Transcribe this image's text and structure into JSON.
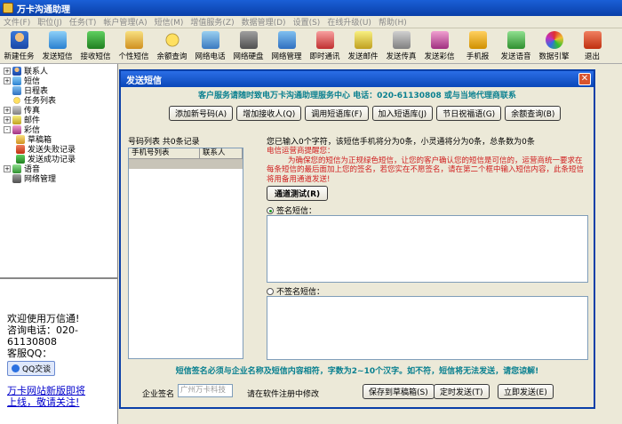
{
  "window": {
    "title": "万卡沟通助理"
  },
  "menu": [
    "文件(F)",
    "职位(J)",
    "任务(T)",
    "帐户管理(A)",
    "短信(M)",
    "增值服务(Z)",
    "数据管理(D)",
    "设置(S)",
    "在线升级(U)",
    "帮助(H)"
  ],
  "toolbar": [
    {
      "label": "新建任务",
      "icon": "user-icon"
    },
    {
      "label": "发送短信",
      "icon": "mail-icon"
    },
    {
      "label": "接收短信",
      "icon": "receive-icon"
    },
    {
      "label": "个性短信",
      "icon": "pen-icon"
    },
    {
      "label": "余额查询",
      "icon": "coin-icon"
    },
    {
      "label": "网络电话",
      "icon": "phone-icon"
    },
    {
      "label": "网络硬盘",
      "icon": "disk-icon"
    },
    {
      "label": "网络管理",
      "icon": "network-icon"
    },
    {
      "label": "即时通讯",
      "icon": "chat-icon"
    },
    {
      "label": "发送邮件",
      "icon": "send-mail-icon"
    },
    {
      "label": "发送传真",
      "icon": "fax-icon"
    },
    {
      "label": "发送彩信",
      "icon": "mms-icon"
    },
    {
      "label": "手机报",
      "icon": "mobile-news-icon"
    },
    {
      "label": "发送语音",
      "icon": "voice-icon"
    },
    {
      "label": "数据引擎",
      "icon": "engine-icon"
    },
    {
      "label": "退出",
      "icon": "exit-icon"
    }
  ],
  "tree": [
    {
      "label": "联系人",
      "level": 0,
      "expander": "+"
    },
    {
      "label": "短信",
      "level": 0,
      "expander": "+"
    },
    {
      "label": "日程表",
      "level": 0,
      "expander": ""
    },
    {
      "label": "任务列表",
      "level": 0,
      "expander": ""
    },
    {
      "label": "传真",
      "level": 0,
      "expander": "+"
    },
    {
      "label": "邮件",
      "level": 0,
      "expander": "+"
    },
    {
      "label": "彩信",
      "level": 0,
      "expander": "-"
    },
    {
      "label": "草稿箱",
      "level": 1,
      "expander": ""
    },
    {
      "label": "发送失败记录",
      "level": 1,
      "expander": ""
    },
    {
      "label": "发送成功记录",
      "level": 1,
      "expander": ""
    },
    {
      "label": "语音",
      "level": 0,
      "expander": "+"
    },
    {
      "label": "网络管理",
      "level": 0,
      "expander": ""
    }
  ],
  "ad": {
    "welcome": "欢迎使用万信通!",
    "hotline_label": "咨询电话：020-",
    "hotline_num": "61130808",
    "qq_label": "客服QQ：",
    "qq_button": "QQ交谈",
    "link_line1": "万卡网站新版即将",
    "link_line2": "上线，敬请关注!"
  },
  "dialog": {
    "title": "发送短信",
    "banner": "客户服务请随时致电万卡沟通助理服务中心  电话：020-61130808  或与当地代理商联系",
    "buttons": [
      "添加新号码(A)",
      "增加接收人(Q)",
      "调用短语库(F)",
      "加入短语库(J)",
      "节日祝福语(G)",
      "余额查询(B)"
    ],
    "number_list_label": "号码列表  共0条记录",
    "col_phone": "手机号列表",
    "col_contact": "联系人",
    "char_count": "您已输入0个字符，该短信手机将分为0条，小灵通将分为0条，总条数为0条",
    "notice_title": "电信运营商提醒您：",
    "notice_body": "为确保您的短信为正规绿色短信，让您的客户确认您的短信是可信的，运营商统一要求在每条短信的最后面加上您的签名，若您实在不愿签名，请在第二个框中输入短信内容，此条短信将用备用通道发送!",
    "channel_test": "通道测试(R)",
    "signed_label": "签名短信：",
    "unsigned_label": "不签名短信：",
    "warning": "短信签名必须与企业名称及短信内容相符，字数为2~10个汉字。如不符，短信将无法发送，请您谅解!",
    "company_label": "企业签名",
    "company_value": "广州万卡科技",
    "company_hint": "请在软件注册中修改",
    "save_draft": "保存到草稿箱(S)",
    "schedule_send": "定时发送(T)",
    "send_now": "立即发送(E)"
  }
}
